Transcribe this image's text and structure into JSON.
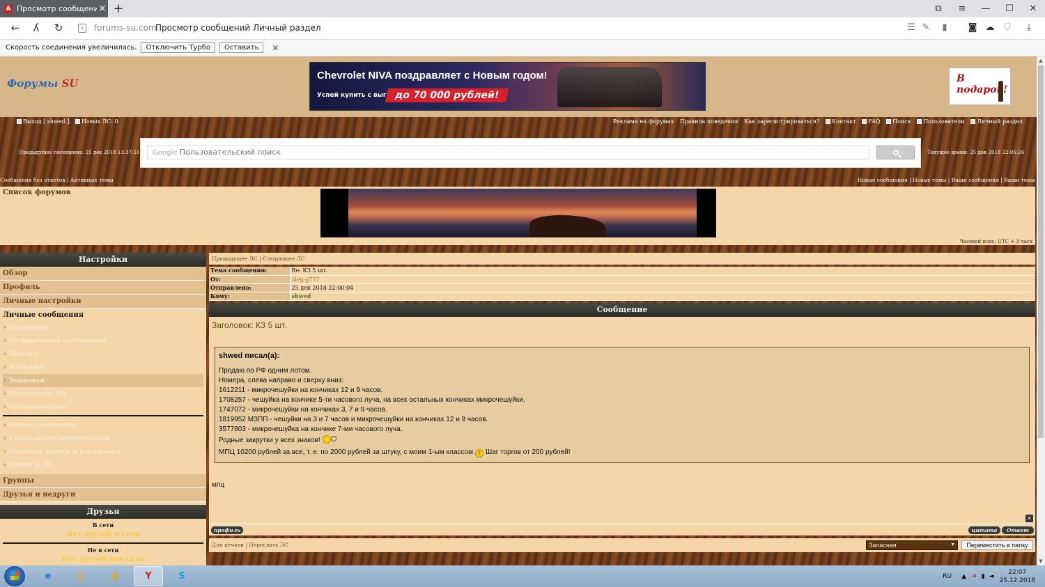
{
  "browser": {
    "tab_title": "Просмотр сообщений /",
    "tab_favicon": "A",
    "new_tab": "+",
    "domain": "forums-su.com",
    "page_title": "Просмотр сообщений Личный раздел",
    "icons": [
      "back-icon",
      "turbo-icon",
      "reload-icon",
      "lock-icon",
      "reader-icon",
      "pen-icon",
      "bookmark-icon",
      "camera-icon",
      "cloud-icon",
      "shield-icon",
      "download-icon"
    ]
  },
  "infobar": {
    "text": "Скорость соединения увеличилась.",
    "disable_turbo": "Отключить Турбо",
    "keep": "Оставить",
    "close": "✕"
  },
  "header": {
    "logo_main": "Форумы",
    "logo_su": "SU",
    "banner_line1": "Chevrolet NIVA поздравляет с Новым годом!",
    "banner_line2": "Успей купить с выгодой",
    "banner_price": "до 70 000 рублей!",
    "gift_text": "В подарок!"
  },
  "toplinks": {
    "logout": "Выход [ shwed ]",
    "new_pm": "Новых ЛС: 0",
    "right": [
      "Реклама на форумах",
      "Правила поведения",
      "Как зарегистрироваться?",
      "Контакт",
      "FAQ",
      "Поиск",
      "Пользователи",
      "Личный раздел"
    ]
  },
  "search": {
    "prev_visit": "Предыдущее посещение: 25 дек 2018 13:37:51",
    "current_time": "Текущее время: 25 дек 2018 22:05:24",
    "google_label": "Google",
    "placeholder": "Пользовательский поиск"
  },
  "sublinks": {
    "left": "Сообщения без ответов | Активные темы",
    "right": "Новые сообщения | Новые темы | Ваши сообщения | Ваши темы"
  },
  "forumlist": {
    "link": "Список форумов",
    "timezone": "Часовой пояс: UTC + 3 часа"
  },
  "sidebar": {
    "settings_title": "Настройки",
    "rows": [
      "Обзор",
      "Профиль",
      "Личные настройки"
    ],
    "pm_title": "Личные сообщения",
    "pm_items": [
      "Входящие",
      "Сохранённые сообщения",
      "Память",
      "Фаберже",
      "Запасная",
      "Исходящие (8)",
      "Отправленные"
    ],
    "pm_active_index": 4,
    "pm_actions": [
      "Новое сообщение",
      "Управление черновиками",
      "Правила, папки и настройки",
      "Поиск в ЛС"
    ],
    "rows_bottom": [
      "Группы",
      "Друзья и недруги"
    ],
    "friends_title": "Друзья",
    "online_label": "В сети",
    "online_none": "Нет друзей в сети",
    "offline_label": "Не в сети",
    "offline_none": "Нет друзей вне сети"
  },
  "main": {
    "pm_nav": "Предыдущее ЛС | Следующее ЛС",
    "info": [
      {
        "label": "Тема сообщения:",
        "value": "Re: КЗ 5 шт."
      },
      {
        "label": "От:",
        "value": "oleg-g777"
      },
      {
        "label": "Отправлено:",
        "value": "25 дек 2018 22:00:04"
      },
      {
        "label": "Кому:",
        "value": "shwed"
      }
    ],
    "message_header": "Сообщение",
    "subject": "Заголовок: КЗ 5 шт.",
    "quote_author": "shwed писал(а):",
    "quote_lines": [
      "Продаю по РФ одним лотом.",
      "Номера, слева направо и сверху вниз:",
      "1612211 - микрочешуйки на кончиках 12 и 9 часов.",
      "1708257 - чешуйка на кончике 5-ти часового луча, на всех остальных кончиках микрочешуйки.",
      "1747072 - микрочешуйки на кончиках 3, 7 и 9 часов.",
      "1819952 МЗПП - чешуйки на 3 и 7 часов и микрочешуйки на кончиках 12 и 9 часов.",
      "3577603 - микрочешуйка на кончике 7-ми часового луча."
    ],
    "quote_line_smile": "Родные закрутки у всех знаков!",
    "quote_price_a": "МПЦ 10200 рублей за все, т. е. по 2000 рублей за штуку, с моим 1-ым классом",
    "quote_price_b": "Шаг торгов от 200 рублей!",
    "reply_text": "мпц",
    "btn_profile": "профиль",
    "btn_quote": "цитата",
    "btn_reply": "Ответ",
    "footer_links": "Для печати | Переслать ЛС",
    "folder_selected": "Запасная",
    "move_button": "Переместить в папку"
  },
  "taskbar": {
    "lang": "RU",
    "time": "22:07",
    "date": "25.12.2018"
  }
}
